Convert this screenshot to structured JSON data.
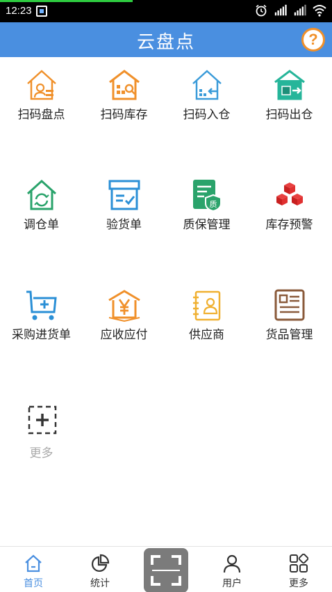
{
  "status_bar": {
    "time": "12:23",
    "progress_fraction": 0.4
  },
  "header": {
    "title": "云盘点",
    "help_label": "?"
  },
  "grid": {
    "items": [
      {
        "label": "扫码盘点",
        "icon": "scan-inventory-house-icon",
        "color": "#f0902a"
      },
      {
        "label": "扫码库存",
        "icon": "scan-stock-warehouse-icon",
        "color": "#f0902a"
      },
      {
        "label": "扫码入仓",
        "icon": "scan-in-house-icon",
        "color": "#3a9bd9"
      },
      {
        "label": "扫码出仓",
        "icon": "scan-out-warehouse-icon",
        "color": "#26b59a"
      },
      {
        "label": "调仓单",
        "icon": "transfer-house-icon",
        "color": "#2aa36b"
      },
      {
        "label": "验货单",
        "icon": "inspection-box-icon",
        "color": "#2a8fd6"
      },
      {
        "label": "质保管理",
        "icon": "warranty-document-icon",
        "color": "#2aa36b"
      },
      {
        "label": "库存预警",
        "icon": "stock-alert-boxes-icon",
        "color": "#e03030"
      },
      {
        "label": "采购进货单",
        "icon": "purchase-cart-icon",
        "color": "#2a8fd6"
      },
      {
        "label": "应收应付",
        "icon": "receivable-payable-yen-icon",
        "color": "#f0902a"
      },
      {
        "label": "供应商",
        "icon": "supplier-contact-card-icon",
        "color": "#f0b030"
      },
      {
        "label": "货品管理",
        "icon": "goods-management-card-icon",
        "color": "#8a5a3a"
      },
      {
        "label": "更多",
        "icon": "add-more-icon",
        "color": "#333333"
      }
    ]
  },
  "tabbar": {
    "tabs": [
      {
        "label": "首页",
        "icon": "home-icon",
        "active": true
      },
      {
        "label": "统计",
        "icon": "pie-chart-icon",
        "active": false
      },
      {
        "label": "",
        "icon": "scan-icon",
        "active": false
      },
      {
        "label": "用户",
        "icon": "user-icon",
        "active": false
      },
      {
        "label": "更多",
        "icon": "grid-more-icon",
        "active": false
      }
    ]
  },
  "colors": {
    "header_bg": "#4a8fe0",
    "active_tab": "#4a8fe0"
  }
}
